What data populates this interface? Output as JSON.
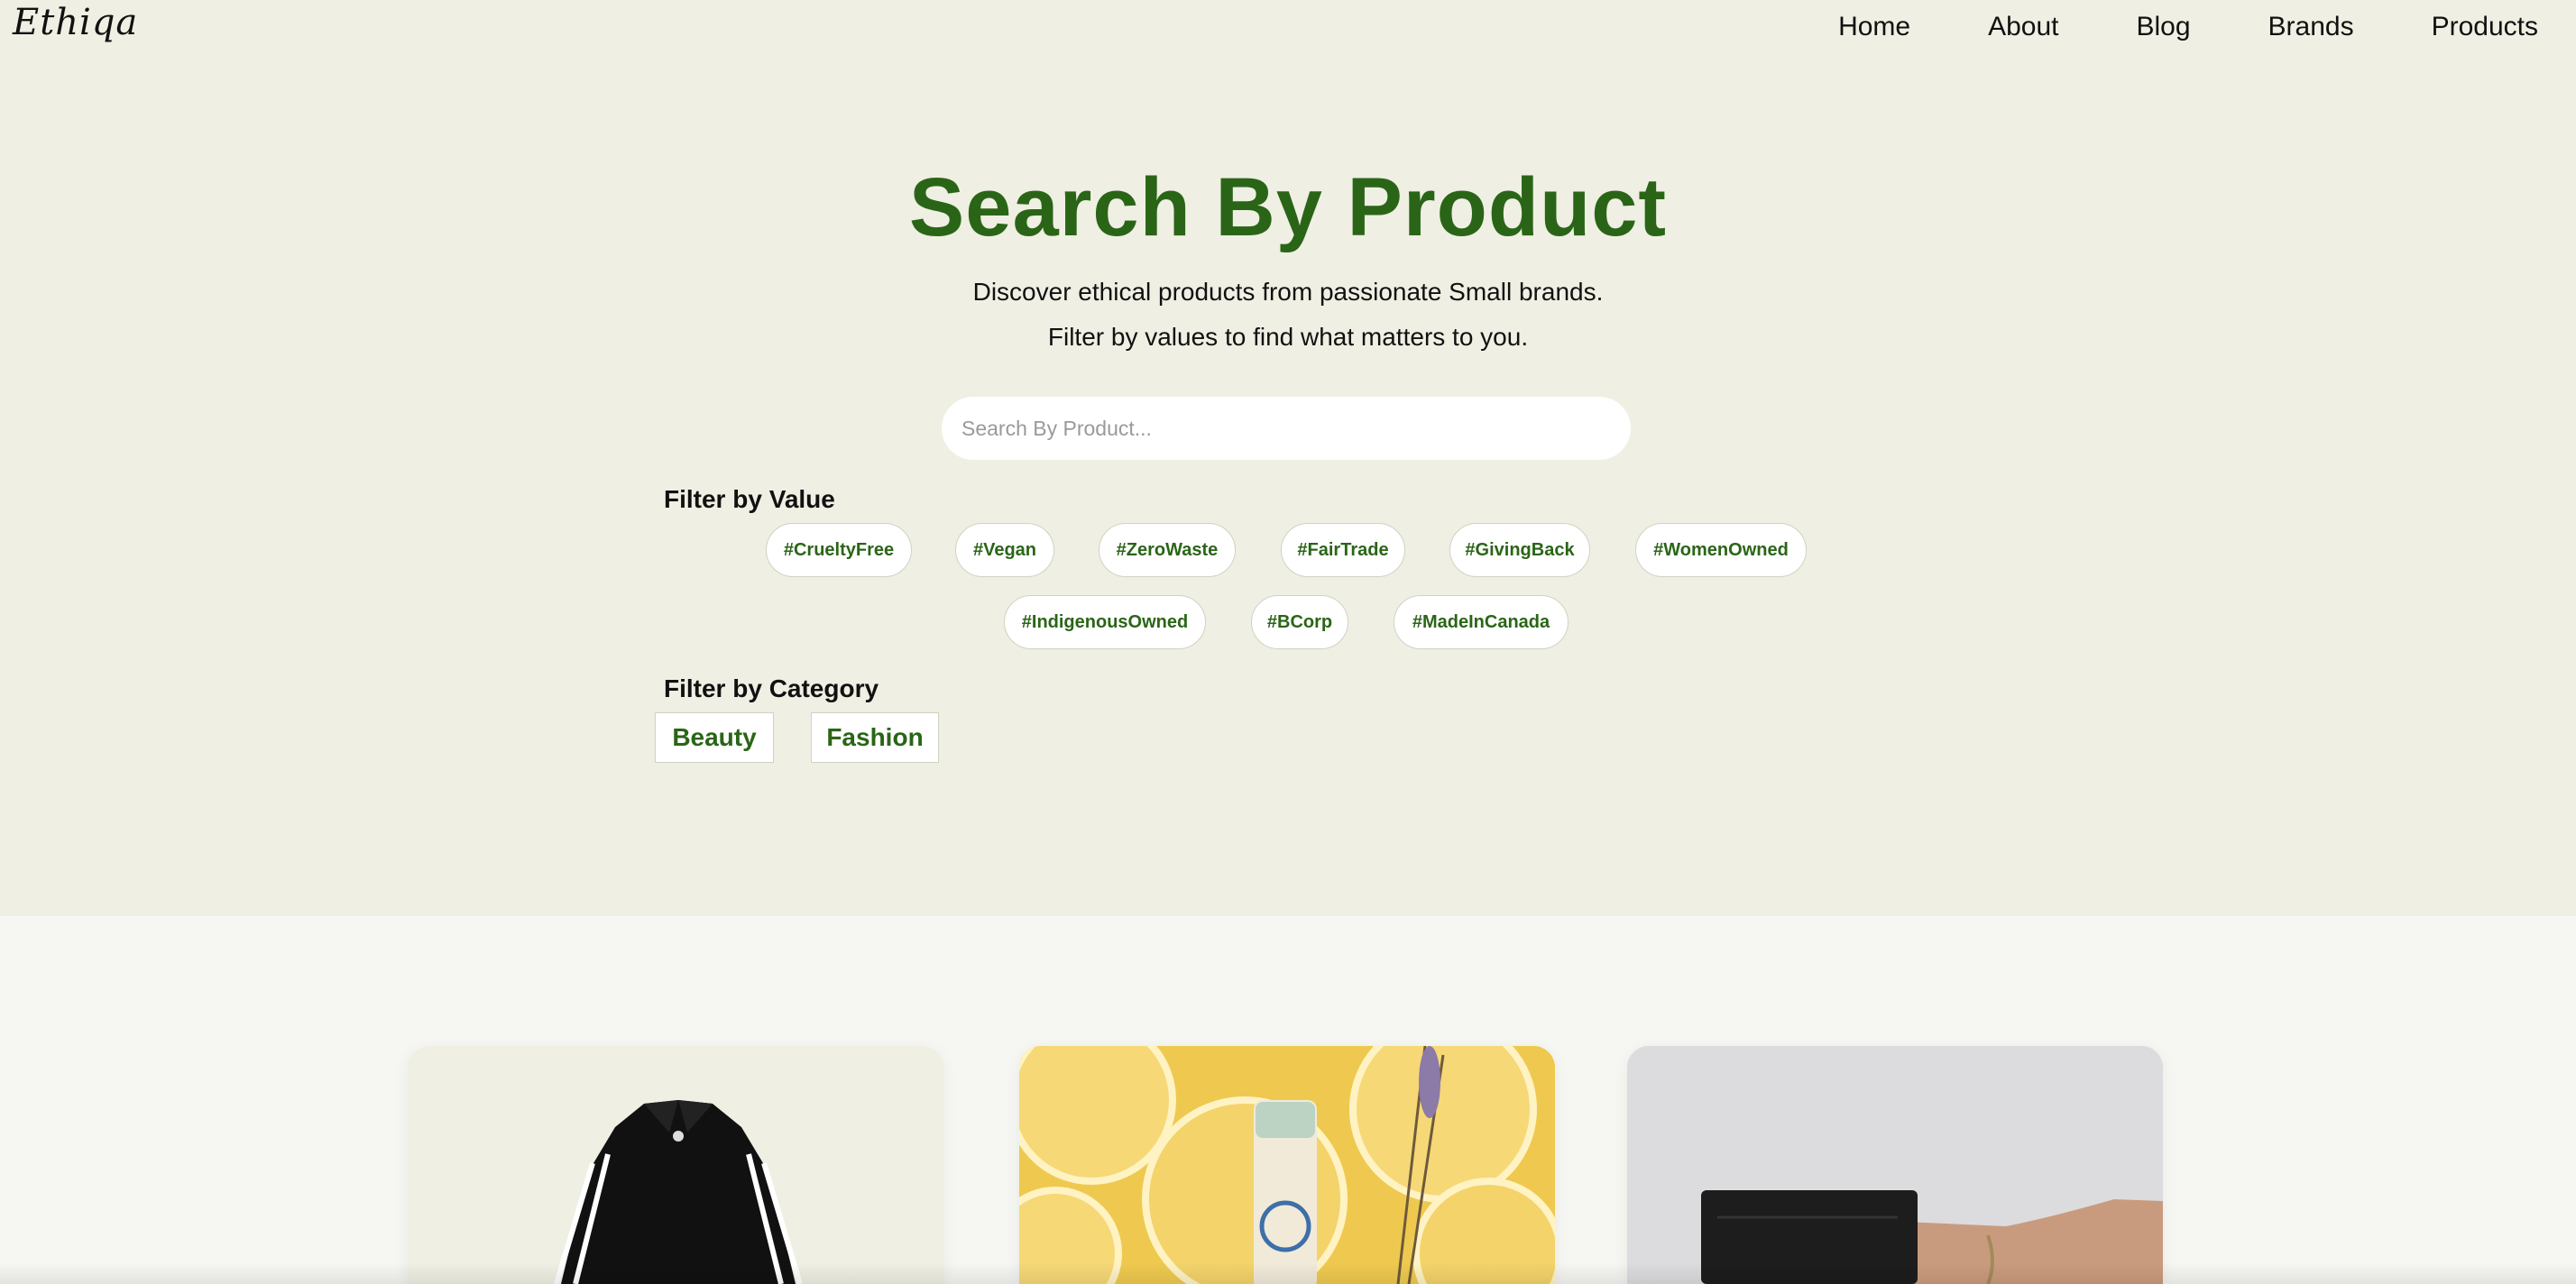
{
  "header": {
    "logo": "Ethiqa",
    "nav": [
      "Home",
      "About",
      "Blog",
      "Brands",
      "Products"
    ]
  },
  "hero": {
    "title": "Search By Product",
    "subtitle_line1": "Discover ethical products from passionate Small brands.",
    "subtitle_line2": "Filter by values to find what matters to you.",
    "search_placeholder": "Search By Product..."
  },
  "filters": {
    "value_label": "Filter by Value",
    "values": [
      "#CrueltyFree",
      "#Vegan",
      "#ZeroWaste",
      "#FairTrade",
      "#GivingBack",
      "#WomenOwned",
      "#IndigenousOwned",
      "#BCorp",
      "#MadeInCanada"
    ],
    "category_label": "Filter by Category",
    "categories": [
      "Beauty",
      "Fashion"
    ]
  },
  "products": [
    {
      "image": "black-white-striped-jacket"
    },
    {
      "image": "lavender-lemon-lip-balm-on-lemon-slices"
    },
    {
      "image": "black-leather-cardholder-in-hand"
    }
  ],
  "colors": {
    "accent": "#2a6517",
    "hero_bg": "#efefe3",
    "page_bg": "#f6f7f2"
  }
}
